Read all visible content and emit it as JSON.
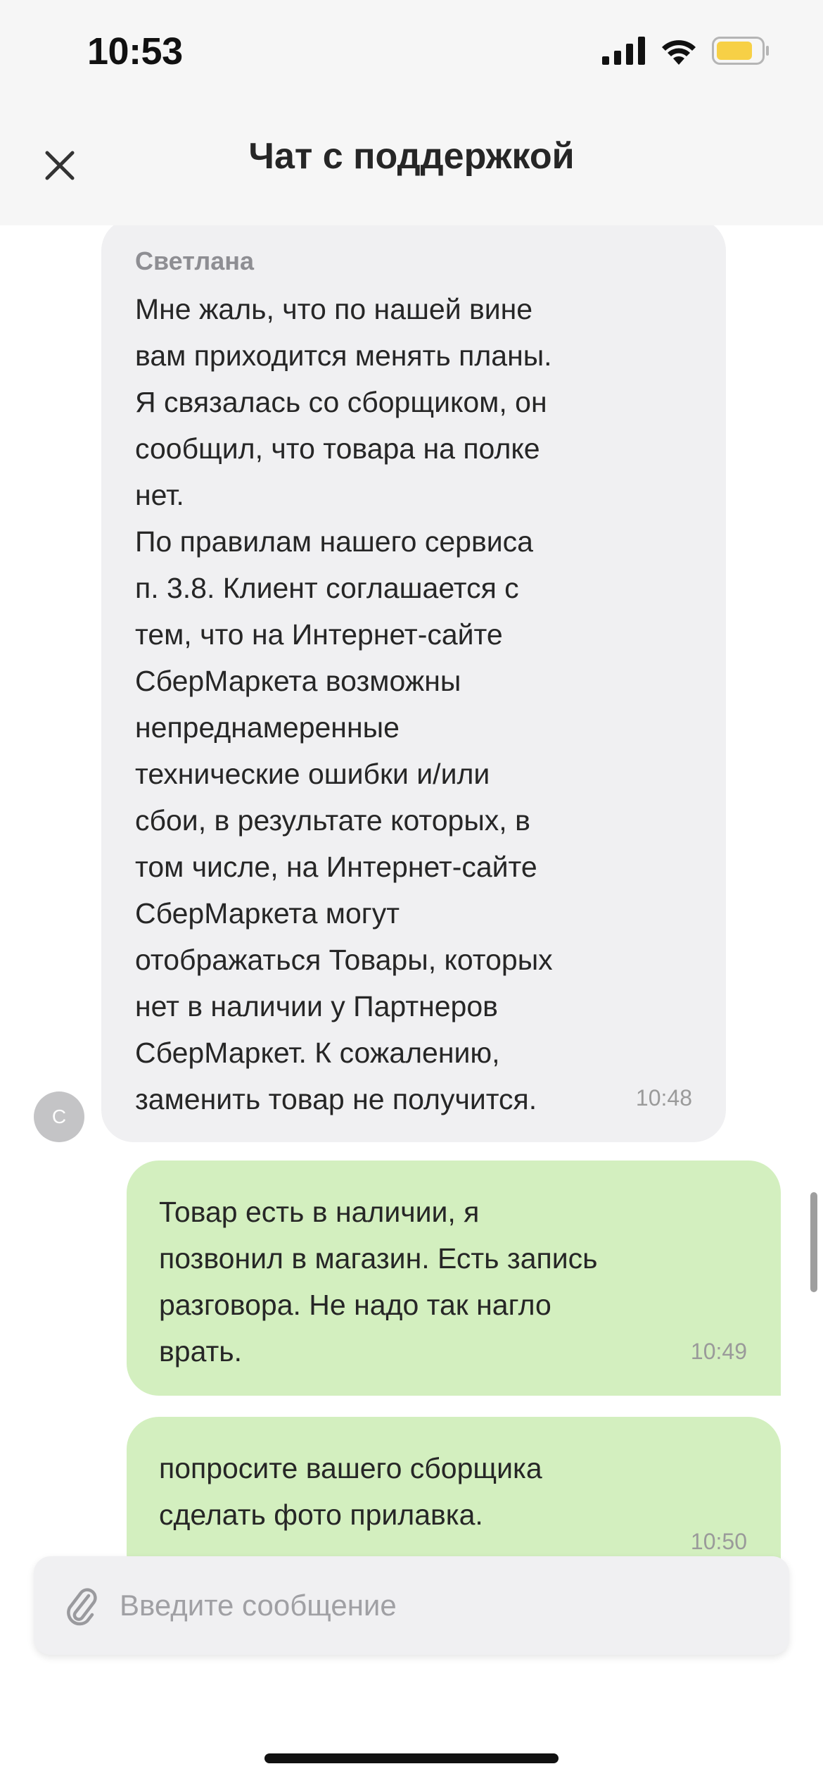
{
  "status_bar": {
    "time": "10:53"
  },
  "header": {
    "title": "Чат с поддержкой",
    "close_icon": "close-icon"
  },
  "messages": [
    {
      "direction": "incoming",
      "sender": "Светлана",
      "text": "Мне жаль, что по нашей вине\nвам приходится менять планы.\nЯ связалась со сборщиком, он\nсообщил, что товара на полке\nнет.\nПо правилам нашего сервиса\nп. 3.8. Клиент соглашается с\nтем, что на Интернет-сайте\nСберМаркета возможны\nнепреднамеренные\nтехнические ошибки и/или\nсбои, в результате которых, в\nтом числе, на Интернет-сайте\nСберМаркета могут\nотображаться Товары, которых\nнет в наличии у Партнеров\nСберМаркет. К сожалению,\nзаменить товар не получится.",
      "time": "10:48",
      "avatar_letter": "С"
    },
    {
      "direction": "outgoing",
      "text": "Товар есть в наличии, я\nпозвонил в магазин. Есть запись\nразговора. Не надо так нагло\nврать.",
      "time": "10:49"
    },
    {
      "direction": "outgoing",
      "text": "попросите вашего сборщика\nсделать фото прилавка.",
      "time": "10:50"
    }
  ],
  "input": {
    "placeholder": "Введите сообщение",
    "value": "",
    "attach_icon": "paperclip-icon"
  },
  "colors": {
    "incoming_bubble": "#f0f0f2",
    "outgoing_bubble": "#d3efbf",
    "battery": "#f7d046"
  }
}
